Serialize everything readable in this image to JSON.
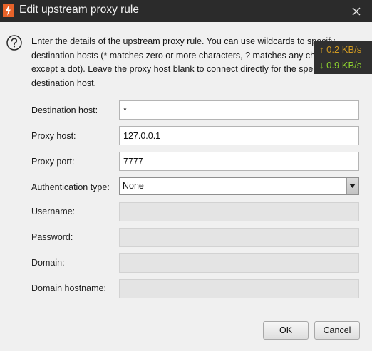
{
  "window": {
    "title": "Edit upstream proxy rule",
    "icon": "burp-app-icon",
    "close_icon": "close-icon"
  },
  "description": "Enter the details of the upstream proxy rule. You can use wildcards to specify destination hosts (* matches zero or more characters, ? matches any character except a dot). Leave the proxy host blank to connect directly for the specified destination host.",
  "form": {
    "destination_host": {
      "label": "Destination host:",
      "value": "*"
    },
    "proxy_host": {
      "label": "Proxy host:",
      "value": "127.0.0.1"
    },
    "proxy_port": {
      "label": "Proxy port:",
      "value": "7777"
    },
    "auth_type": {
      "label": "Authentication type:",
      "value": "None"
    },
    "username": {
      "label": "Username:",
      "value": ""
    },
    "password": {
      "label": "Password:",
      "value": ""
    },
    "domain": {
      "label": "Domain:",
      "value": ""
    },
    "domain_hostname": {
      "label": "Domain hostname:",
      "value": ""
    }
  },
  "buttons": {
    "ok": "OK",
    "cancel": "Cancel"
  },
  "netspeed": {
    "upload": "0.2 KB/s",
    "download": "0.9 KB/s",
    "up_arrow": "↑",
    "down_arrow": "↓",
    "up_color": "#d19a22",
    "down_color": "#8dd12f"
  },
  "colors": {
    "titlebar": "#2b2b2b",
    "dialog_bg": "#f0f0f0",
    "accent": "#e8632a"
  }
}
